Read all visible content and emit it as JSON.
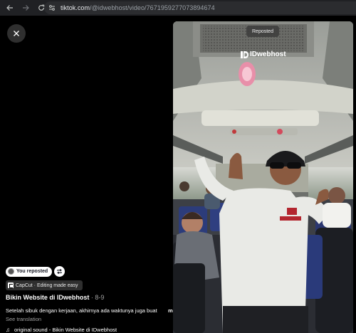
{
  "browser": {
    "url_host": "tiktok.com",
    "url_path": "/@idwebhost/video/7671959277073894674"
  },
  "video_overlay": {
    "reposted_label": "Reposted",
    "watermark": "IDwebhost"
  },
  "info": {
    "reposted_label": "You reposted",
    "capcut_label": "CapCut · Editing made easy",
    "author": "Bikin Website di IDwebhost",
    "separator": "·",
    "date": "8-9",
    "caption": "Setelah sibuk dengan kerjaan, akhirnya ada waktunya juga buat",
    "more": "more",
    "see_translation": "See translation",
    "sound": "original sound - Bikin Website di IDwebhost"
  }
}
